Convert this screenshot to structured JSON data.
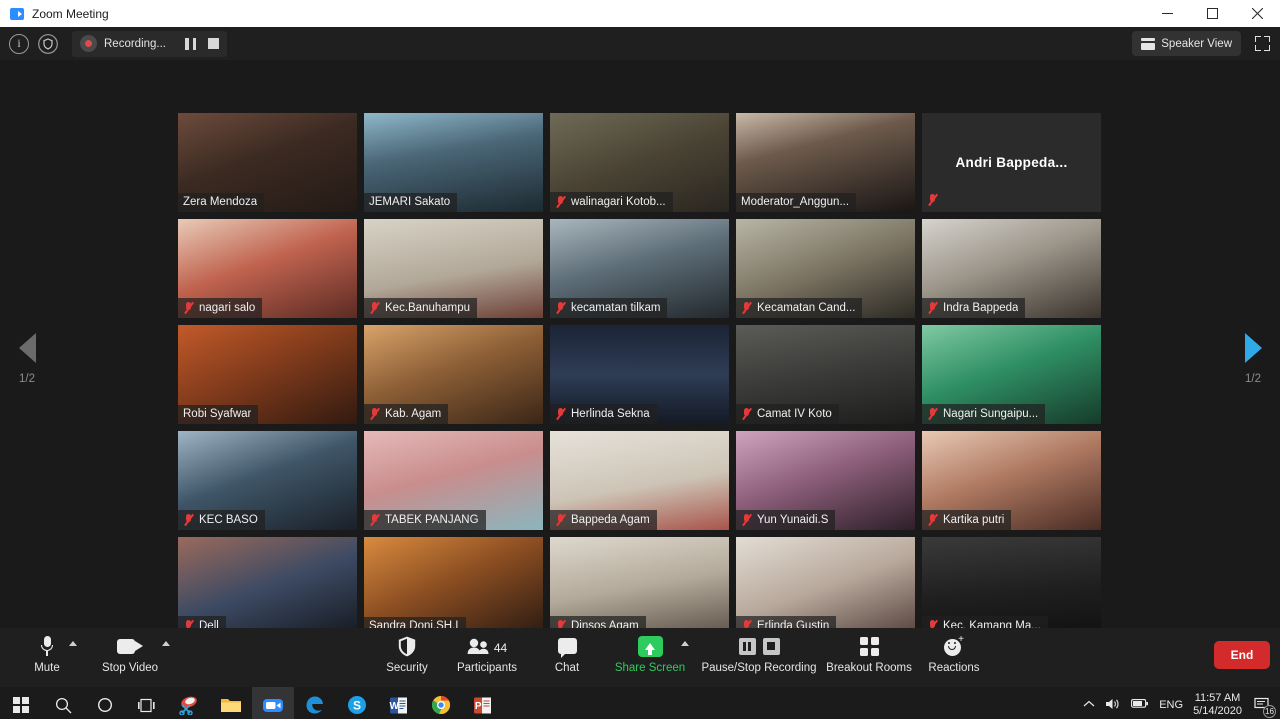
{
  "window": {
    "title": "Zoom Meeting",
    "app_icon": "zoom-video-icon",
    "minimize_label": "Minimize",
    "maximize_label": "Maximize",
    "close_label": "Close"
  },
  "header": {
    "info_icon": "info-icon",
    "encryption_icon": "shield-icon",
    "recording_label": "Recording...",
    "pause_icon": "pause-icon",
    "stop_icon": "stop-icon",
    "speaker_view_label": "Speaker View",
    "speaker_view_icon": "layout-icon",
    "fullscreen_icon": "fullscreen-icon"
  },
  "gallery": {
    "prev_page": {
      "icon": "triangle-left-icon",
      "label": "1/2"
    },
    "next_page": {
      "icon": "triangle-right-icon",
      "label": "1/2"
    },
    "participants": [
      {
        "name": "Zera Mendoza",
        "muted": false,
        "active_speaker": false,
        "video": true,
        "bg": "linear-gradient(160deg,#6d4b3c 0%,#3b2a22 45%,#241a15 100%)"
      },
      {
        "name": "JEMARI Sakato",
        "muted": false,
        "active_speaker": false,
        "video": true,
        "bg": "linear-gradient(170deg,#8fb8c9 0%,#4a6677 40%,#1d2a31 100%)"
      },
      {
        "name": "walinagari Kotob...",
        "muted": true,
        "active_speaker": false,
        "video": true,
        "bg": "linear-gradient(160deg,#6f6a57 0%,#4a4334 50%,#2a2620 100%)"
      },
      {
        "name": "Moderator_Anggun...",
        "muted": false,
        "active_speaker": false,
        "video": true,
        "bg": "linear-gradient(165deg,#c9b9a8 0%,#6d5a4c 35%,#1a1614 100%)"
      },
      {
        "name": "Andri  Bappeda...",
        "muted": true,
        "active_speaker": false,
        "video": false,
        "bg": "#2b2b2b"
      },
      {
        "name": "nagari salo",
        "muted": true,
        "active_speaker": false,
        "video": true,
        "bg": "linear-gradient(160deg,#e8cbb7 0%,#c0634f 45%,#5c2b23 100%)"
      },
      {
        "name": "Kec.Banuhampu",
        "muted": true,
        "active_speaker": false,
        "video": true,
        "bg": "linear-gradient(170deg,#d8d2c6 0%,#b2a899 55%,#6d3f35 100%)"
      },
      {
        "name": "kecamatan tilkam",
        "muted": true,
        "active_speaker": false,
        "video": true,
        "bg": "linear-gradient(165deg,#a9b6bd 0%,#5d6d77 45%,#23292e 100%)"
      },
      {
        "name": "Kecamatan Cand...",
        "muted": true,
        "active_speaker": false,
        "video": true,
        "bg": "linear-gradient(160deg,#b7b6a6 0%,#7c7463 50%,#2c2a24 100%)"
      },
      {
        "name": "Indra Bappeda",
        "muted": true,
        "active_speaker": false,
        "video": true,
        "bg": "linear-gradient(160deg,#d5d3cd 0%,#9c958a 45%,#3a342d 100%)"
      },
      {
        "name": "Robi Syafwar",
        "muted": false,
        "active_speaker": true,
        "video": true,
        "bg": "linear-gradient(155deg,#c25a2a 0%,#8a3f1d 40%,#321a10 100%)"
      },
      {
        "name": "Kab. Agam",
        "muted": true,
        "active_speaker": false,
        "video": true,
        "bg": "linear-gradient(160deg,#d8a36a 0%,#8d5f36 45%,#3a2617 100%)"
      },
      {
        "name": "Herlinda Sekna",
        "muted": true,
        "active_speaker": false,
        "video": true,
        "bg": "linear-gradient(180deg,#1c2435 0%,#2e3c55 50%,#141a26 100%)"
      },
      {
        "name": "Camat IV Koto",
        "muted": true,
        "active_speaker": false,
        "video": true,
        "bg": "linear-gradient(170deg,#5b5b58 0%,#3a3a38 50%,#1d1d1c 100%)"
      },
      {
        "name": "Nagari Sungaipu...",
        "muted": true,
        "active_speaker": false,
        "video": true,
        "bg": "linear-gradient(160deg,#7fc9a3 0%,#2f8f64 45%,#163b2a 100%)"
      },
      {
        "name": "KEC BASO",
        "muted": true,
        "active_speaker": false,
        "video": true,
        "bg": "linear-gradient(160deg,#9fb4c4 0%,#3f5668 45%,#1a2029 100%)"
      },
      {
        "name": "TABEK PANJANG",
        "muted": true,
        "active_speaker": false,
        "video": true,
        "bg": "linear-gradient(165deg,#e5b9b9 0%,#c98d8d 45%,#8ab6bd 100%)"
      },
      {
        "name": "Bappeda Agam",
        "muted": true,
        "active_speaker": false,
        "video": true,
        "bg": "linear-gradient(170deg,#e6e2da 0%,#cdc4b6 55%,#a8544a 100%)"
      },
      {
        "name": "Yun Yunaidi.S",
        "muted": true,
        "active_speaker": false,
        "video": true,
        "bg": "linear-gradient(160deg,#cfa3bd 0%,#8d5f7b 45%,#2e1f29 100%)"
      },
      {
        "name": "Kartika putri",
        "muted": true,
        "active_speaker": false,
        "video": true,
        "bg": "linear-gradient(160deg,#e8c9b4 0%,#b07a62 45%,#4a2c24 100%)"
      },
      {
        "name": "Dell",
        "muted": true,
        "active_speaker": false,
        "video": true,
        "bg": "linear-gradient(160deg,#9a6a5c 0%,#3d4a63 50%,#151a22 100%)"
      },
      {
        "name": "Sandra Doni,SH.I",
        "muted": false,
        "active_speaker": false,
        "video": true,
        "bg": "linear-gradient(155deg,#d98b3f 0%,#8d4f22 45%,#2a1a12 100%)"
      },
      {
        "name": "Dinsos Agam",
        "muted": true,
        "active_speaker": false,
        "video": true,
        "bg": "linear-gradient(170deg,#ded8cd 0%,#b4aa9b 50%,#5c5248 100%)"
      },
      {
        "name": "Erlinda Gustin",
        "muted": true,
        "active_speaker": false,
        "video": true,
        "bg": "linear-gradient(160deg,#e3ddd4 0%,#b8a89c 50%,#55433c 100%)"
      },
      {
        "name": "Kec. Kamang Ma...",
        "muted": true,
        "active_speaker": false,
        "video": true,
        "bg": "linear-gradient(175deg,#3a3a3a 0%,#1f1f1f 55%,#111111 100%)"
      }
    ]
  },
  "toolbar": {
    "items": [
      {
        "label": "Mute",
        "icon": "microphone-icon",
        "has_caret": true
      },
      {
        "label": "Stop Video",
        "icon": "camera-icon",
        "has_caret": true
      },
      {
        "label": "Security",
        "icon": "shield-icon",
        "has_caret": false
      },
      {
        "label": "Participants",
        "icon": "people-icon",
        "count": "44",
        "has_caret": false
      },
      {
        "label": "Chat",
        "icon": "chat-bubble-icon",
        "has_caret": false
      },
      {
        "label": "Share Screen",
        "icon": "share-screen-icon",
        "has_caret": true
      },
      {
        "label": "Pause/Stop Recording",
        "icon": "pause-stop-recording-icon",
        "has_caret": false
      },
      {
        "label": "Breakout Rooms",
        "icon": "breakout-rooms-icon",
        "has_caret": false
      },
      {
        "label": "Reactions",
        "icon": "reactions-icon",
        "has_caret": false
      }
    ],
    "end_label": "End",
    "accent_green": "#2ecc5f",
    "end_red": "#d32b2b"
  },
  "taskbar": {
    "start_icon": "windows-start-icon",
    "apps": [
      {
        "name": "search-icon"
      },
      {
        "name": "cortana-icon"
      },
      {
        "name": "task-view-icon"
      },
      {
        "name": "snip-sketch-icon"
      },
      {
        "name": "file-explorer-icon"
      },
      {
        "name": "zoom-icon"
      },
      {
        "name": "edge-icon"
      },
      {
        "name": "skype-icon"
      },
      {
        "name": "word-icon"
      },
      {
        "name": "chrome-icon"
      },
      {
        "name": "powerpoint-icon"
      }
    ],
    "tray": {
      "chevron_icon": "chevron-up-icon",
      "volume_icon": "volume-icon",
      "battery_icon": "battery-icon",
      "language": "ENG",
      "time": "11:57 AM",
      "date": "5/14/2020",
      "notification_icon": "notification-icon",
      "notification_count": "16"
    }
  }
}
